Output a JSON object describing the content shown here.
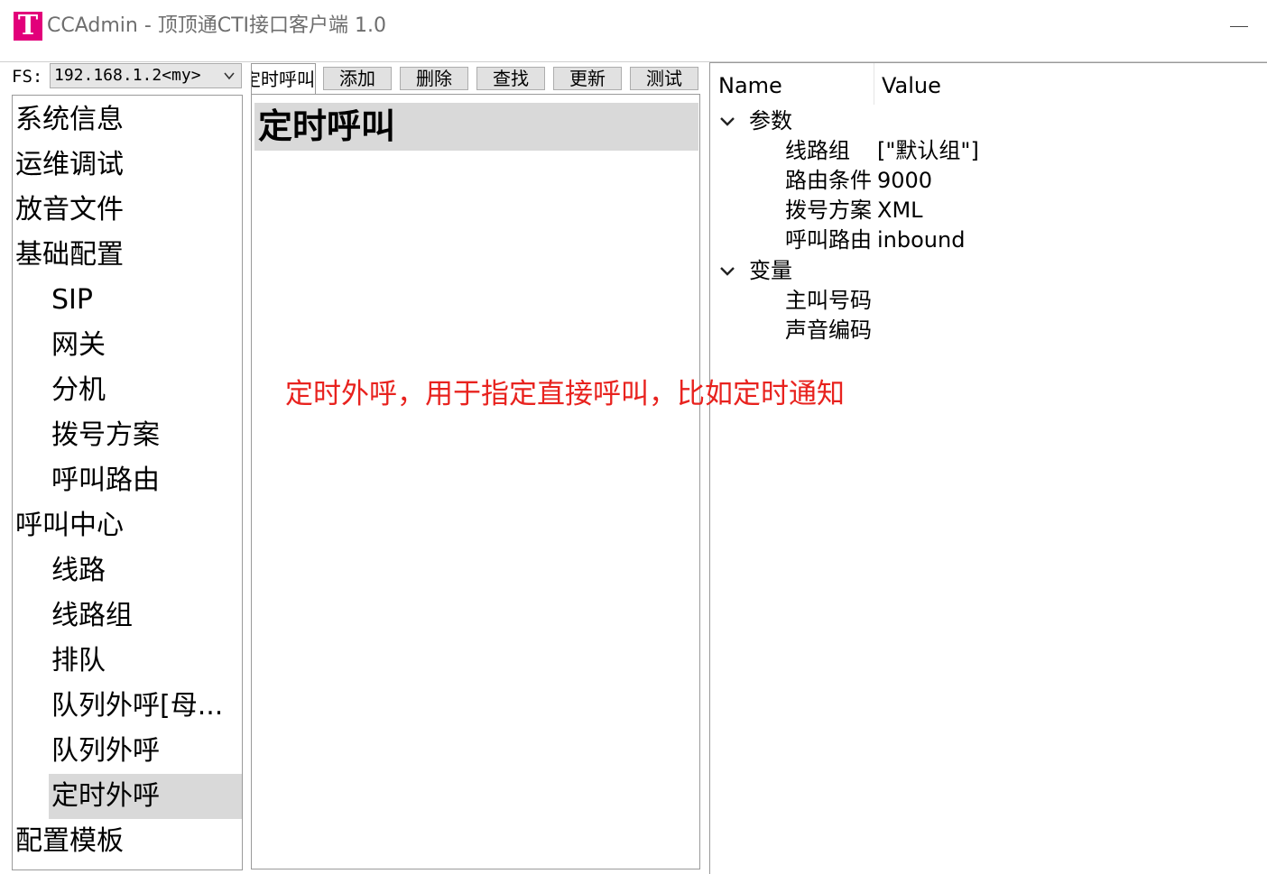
{
  "window": {
    "logo_letter": "T",
    "title": "CCAdmin - 顶顶通CTI接口客户端 1.0"
  },
  "server": {
    "label": "FS:",
    "value": "192.168.1.2<my>"
  },
  "nav": {
    "items": [
      {
        "label": "系统信息",
        "level": 1
      },
      {
        "label": "运维调试",
        "level": 1
      },
      {
        "label": "放音文件",
        "level": 1
      },
      {
        "label": "基础配置",
        "level": 1
      },
      {
        "label": "SIP",
        "level": 2
      },
      {
        "label": "网关",
        "level": 2
      },
      {
        "label": "分机",
        "level": 2
      },
      {
        "label": "拨号方案",
        "level": 2
      },
      {
        "label": "呼叫路由",
        "level": 2
      },
      {
        "label": "呼叫中心",
        "level": 1
      },
      {
        "label": "线路",
        "level": 2
      },
      {
        "label": "线路组",
        "level": 2
      },
      {
        "label": "排队",
        "level": 2
      },
      {
        "label": "队列外呼[母...",
        "level": 2
      },
      {
        "label": "队列外呼",
        "level": 2
      },
      {
        "label": "定时外呼",
        "level": 2,
        "selected": true
      },
      {
        "label": "配置模板",
        "level": 1
      }
    ]
  },
  "toolbar": {
    "current_tab": "定时呼叫",
    "add": "添加",
    "delete": "删除",
    "search": "查找",
    "update": "更新",
    "test": "测试"
  },
  "content": {
    "header": "定时呼叫",
    "description": "定时外呼，用于指定直接呼叫，比如定时通知",
    "description_color": "#e8221e"
  },
  "properties": {
    "col_name": "Name",
    "col_value": "Value",
    "groups": [
      {
        "label": "参数",
        "expanded": true,
        "rows": [
          {
            "name": "线路组",
            "value": "[\"默认组\"]"
          },
          {
            "name": "路由条件",
            "value": "9000"
          },
          {
            "name": "拨号方案",
            "value": "XML"
          },
          {
            "name": "呼叫路由",
            "value": "inbound"
          }
        ]
      },
      {
        "label": "变量",
        "expanded": true,
        "rows": [
          {
            "name": "主叫号码",
            "value": ""
          },
          {
            "name": "声音编码",
            "value": ""
          }
        ]
      }
    ]
  },
  "colors": {
    "logo": "#e2007a",
    "selection": "#d9d9d9",
    "button_face": "#e1e1e1"
  }
}
